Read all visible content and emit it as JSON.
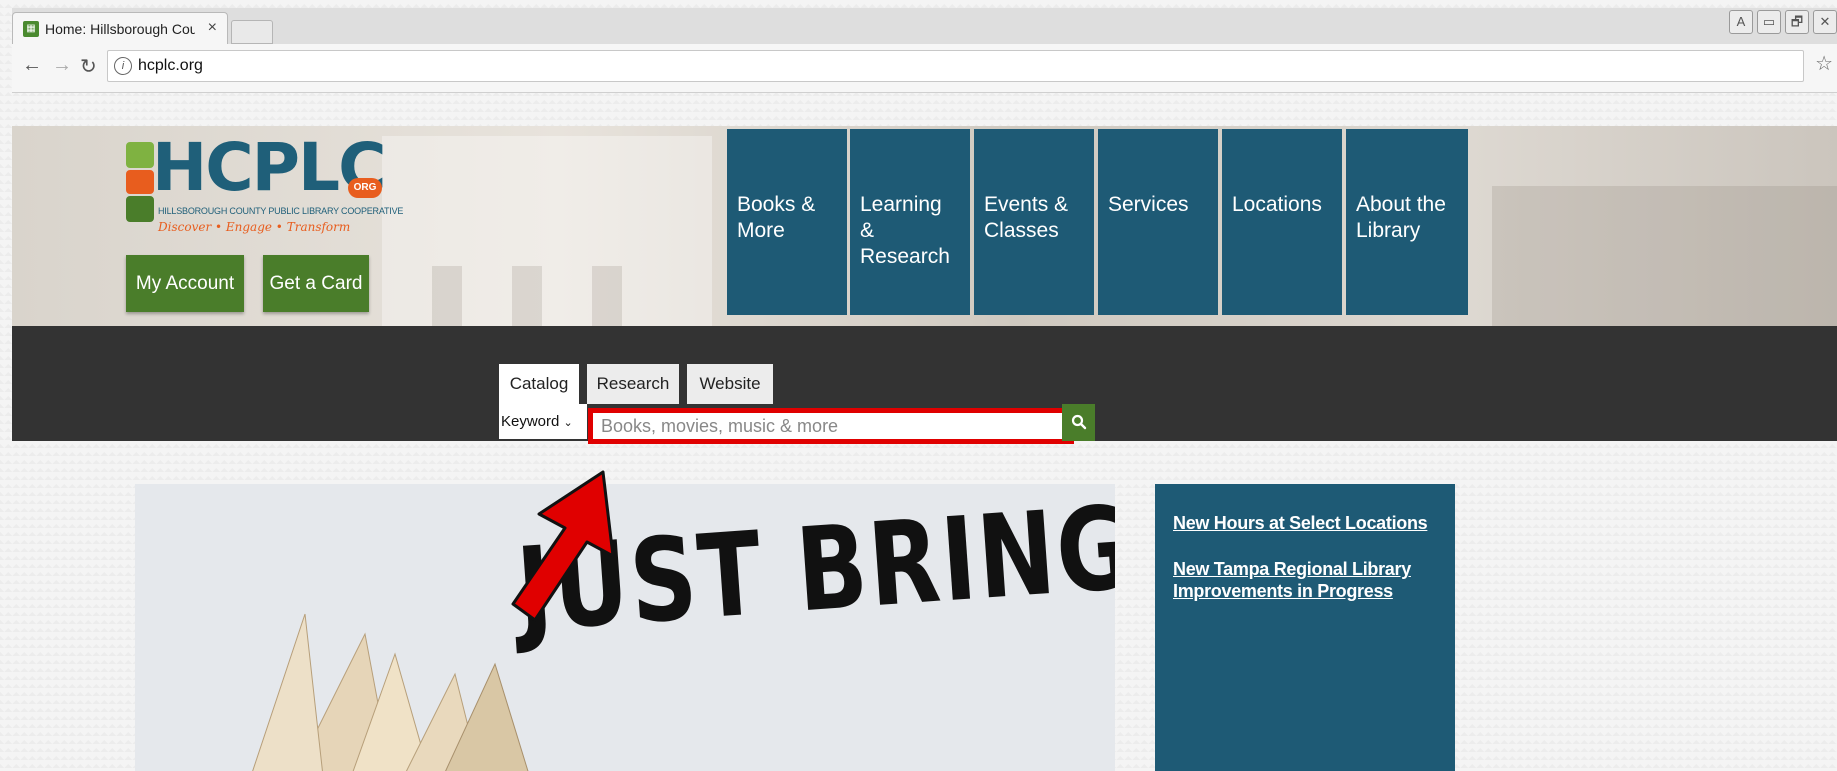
{
  "browser": {
    "tab_title": "Home: Hillsborough Cou",
    "tab_close": "×",
    "url": "hcplc.org",
    "window_controls": [
      "A",
      "▭",
      "🗗",
      "✕"
    ],
    "icons": {
      "back": "back-arrow-icon",
      "forward": "forward-arrow-icon",
      "reload": "reload-icon",
      "info": "info-icon",
      "bookmark": "star-icon"
    }
  },
  "site": {
    "logo": {
      "title": "HCPLC",
      "org_badge": "ORG",
      "subtitle": "HILLSBOROUGH COUNTY PUBLIC LIBRARY COOPERATIVE",
      "tagline": "Discover • Engage • Transform"
    },
    "header_buttons": {
      "my_account": "My Account",
      "get_card": "Get a Card"
    },
    "nav": [
      {
        "label": "Books & More"
      },
      {
        "label": "Learning & Research"
      },
      {
        "label": "Events & Classes"
      },
      {
        "label": "Services"
      },
      {
        "label": "Locations"
      },
      {
        "label": "About the Library"
      }
    ],
    "search": {
      "tabs": [
        "Catalog",
        "Research",
        "Website"
      ],
      "active_tab": "Catalog",
      "mode": "Keyword",
      "placeholder": "Books, movies, music & more",
      "submit_icon": "search-icon"
    },
    "hero": {
      "headline": "JUST BRING IT"
    },
    "news": [
      "New Hours at Select Locations",
      "New Tampa Regional Library Improvements in Progress"
    ]
  },
  "colors": {
    "brand_blue": "#1e5a75",
    "brand_green": "#4a7d2a",
    "brand_orange": "#e85d1e",
    "highlight_red": "#e00000",
    "search_band": "#333333"
  }
}
